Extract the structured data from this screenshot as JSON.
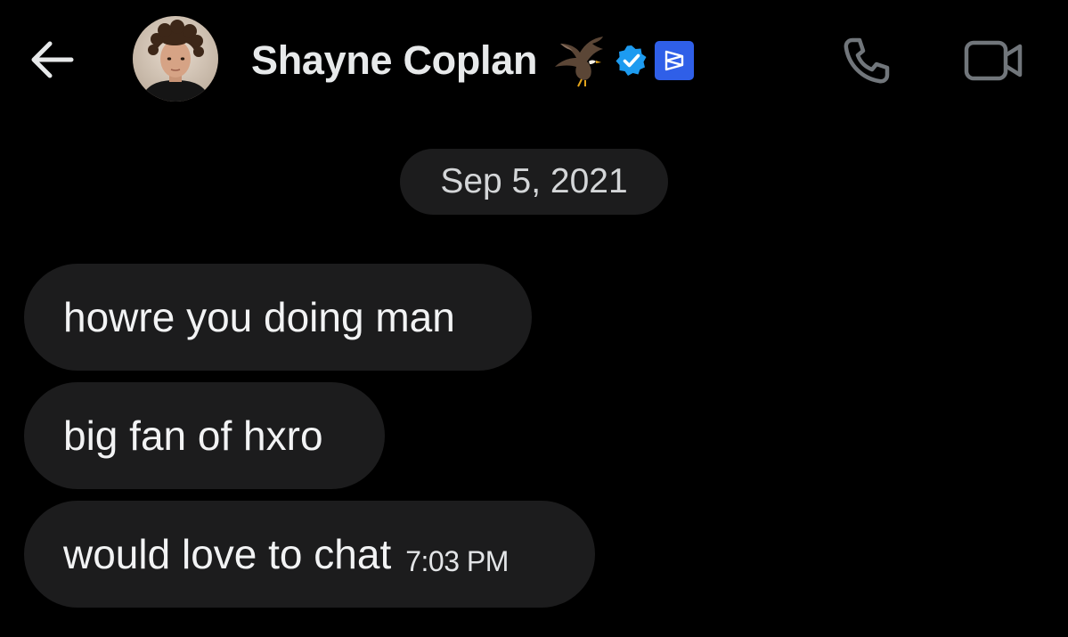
{
  "header": {
    "name": "Shayne Coplan",
    "name_emoji": "eagle-icon",
    "verified_badge": "verified-badge-icon",
    "affiliate_badge": "polymarket-affiliate-icon",
    "colors": {
      "verified": "#1d9bf0",
      "affiliate": "#2f5fe8"
    }
  },
  "conversation": {
    "date_divider": "Sep 5, 2021",
    "messages": [
      {
        "text": "howre you doing man"
      },
      {
        "text": "big fan of hxro"
      },
      {
        "text": "would love to chat",
        "time": "7:03 PM"
      }
    ]
  },
  "colors": {
    "background": "#000000",
    "bubble": "#1c1c1d",
    "text": "#f2f3f4",
    "icon": "#71767b"
  }
}
